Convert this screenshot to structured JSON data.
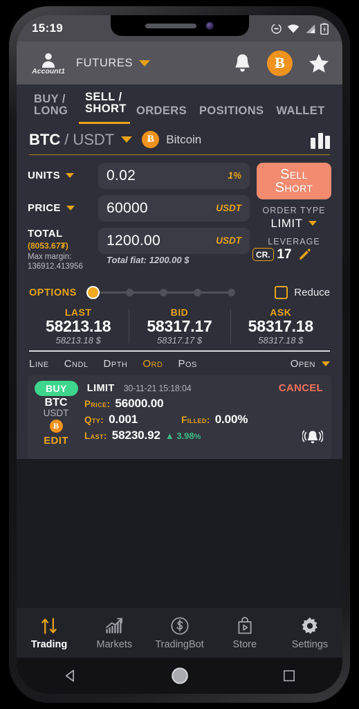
{
  "status_bar": {
    "time": "15:19",
    "icons": [
      "dnd-icon",
      "wifi-icon",
      "signal-icon",
      "battery-charging-icon"
    ]
  },
  "header": {
    "account_label": "Account1",
    "market_selector": "FUTURES",
    "icons": [
      "bell-icon",
      "bitcoin-icon",
      "star-icon"
    ]
  },
  "main_tabs": [
    {
      "label_line1": "BUY /",
      "label_line2": "LONG",
      "active": false
    },
    {
      "label_line1": "SELL /",
      "label_line2": "SHORT",
      "active": true
    },
    {
      "label_line1": "ORDERS",
      "label_line2": "",
      "active": false
    },
    {
      "label_line1": "POSITIONS",
      "label_line2": "",
      "active": false
    },
    {
      "label_line1": "WALLET",
      "label_line2": "",
      "active": false
    }
  ],
  "pair": {
    "base": "BTC",
    "separator": "/",
    "quote": "USDT",
    "coin_symbol": "Ƀ",
    "name": "Bitcoin"
  },
  "form": {
    "units": {
      "label": "UNITS",
      "value": "0.02",
      "suffix": "1%"
    },
    "price": {
      "label": "PRICE",
      "value": "60000",
      "suffix": "USDT"
    },
    "total": {
      "label": "TOTAL",
      "sub": "(8053.67₮)",
      "value": "1200.00",
      "suffix": "USDT",
      "fiat": "Total fiat: 1200.00 $"
    },
    "max_margin_label": "Max margin:",
    "max_margin_value": "136912.413956",
    "sell_button_line1": "Sell",
    "sell_button_line2": "Short",
    "order_type_label": "ORDER TYPE",
    "order_type_value": "LIMIT",
    "leverage_label": "LEVERAGE",
    "leverage_value": "17",
    "cross_badge": "CR.",
    "edit_leverage_icon": "pencil-icon"
  },
  "options": {
    "label": "OPTIONS",
    "steps": 5,
    "selected_step": 0,
    "reduce_label": "Reduce",
    "reduce_checked": false
  },
  "prices": [
    {
      "head": "LAST",
      "value": "58213.18",
      "fiat": "58213.18 $"
    },
    {
      "head": "BID",
      "value": "58317.17",
      "fiat": "58317.17 $"
    },
    {
      "head": "ASK",
      "value": "58317.18",
      "fiat": "58317.18 $"
    }
  ],
  "chart_tabs": {
    "items": [
      {
        "label": "Line",
        "active": false
      },
      {
        "label": "Cndl",
        "active": false
      },
      {
        "label": "Dpth",
        "active": false
      },
      {
        "label": "Ord",
        "active": true
      },
      {
        "label": "Pos",
        "active": false
      }
    ],
    "filter": "Open"
  },
  "order_card": {
    "side": "BUY",
    "type": "LIMIT",
    "datetime": "30-11-21 15:18:04",
    "cancel_label": "CANCEL",
    "base": "BTC",
    "quote": "USDT",
    "coin_symbol": "Ƀ",
    "edit_label": "EDIT",
    "price_label": "Price:",
    "price_value": "56000.00",
    "qty_label": "Qty:",
    "qty_value": "0.001",
    "filled_label": "Filled:",
    "filled_value": "0.00%",
    "last_label": "Last:",
    "last_value": "58230.92",
    "change_value": "▲ 3.98",
    "change_unit": "%",
    "alarm_icon": "bell-ring-icon"
  },
  "bottom_nav": [
    {
      "label": "Trading",
      "icon": "exchange-arrows-icon",
      "active": true
    },
    {
      "label": "Markets",
      "icon": "bar-chart-up-icon",
      "active": false
    },
    {
      "label": "TradingBot",
      "label_alt": "TradingBot",
      "icon": "dollar-circle-icon",
      "active": false
    },
    {
      "label": "Store",
      "icon": "shopping-bag-play-icon",
      "active": false
    },
    {
      "label": "Settings",
      "icon": "gear-icon",
      "active": false
    }
  ],
  "android_nav": [
    {
      "name": "back-button",
      "icon": "triangle-left-icon"
    },
    {
      "name": "home-button",
      "icon": "circle-icon"
    },
    {
      "name": "recents-button",
      "icon": "square-icon"
    }
  ],
  "colors": {
    "accent_gold": "#e8a317",
    "sell_salmon": "#f28b70",
    "buy_green": "#3dd68c",
    "cancel_red": "#f2715a",
    "bitcoin_orange": "#f0931e",
    "screen_bg": "#2e2f38",
    "header_bg": "#55555b"
  }
}
